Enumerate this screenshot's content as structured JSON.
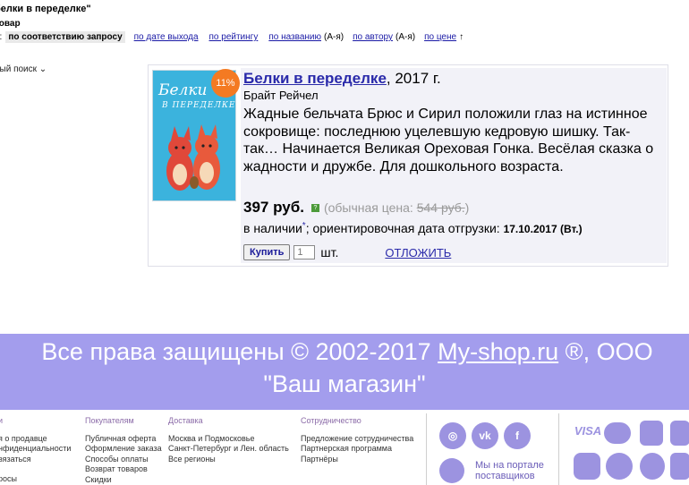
{
  "search": {
    "title": "белки в переделке\"",
    "found": "товар",
    "sort_prefix": "а:",
    "sort_active": "по соответствию запросу",
    "sort_by_date": "по дате выхода",
    "sort_by_rating": "по рейтингу",
    "sort_by_name": "по названию",
    "sort_by_name_note": "(А-я)",
    "sort_by_author": "по автору",
    "sort_by_author_note": "(А-я)",
    "sort_by_price": "по цене",
    "sort_arrow": "↑",
    "advanced": "ный поиск ⌄"
  },
  "product": {
    "discount": "11%",
    "cover_title": "Белки",
    "cover_subtitle": "В ПЕРЕДЕЛКЕ",
    "title": "Белки в переделке",
    "year": ", 2017 г.",
    "author": "Брайт Рейчел",
    "description": "Жадные бельчата Брюс и Сирил положили глаз на истинное сокровище: последнюю уцелевшую кедровую шишку. Так-так… Начинается Великая Ореховая Гонка. Весёлая сказка о жадности и дружбе. Для дошкольного возраста.",
    "price": "397 руб.",
    "info_icon": "?",
    "old_price_prefix": "(обычная цена: ",
    "old_price": "544 руб.",
    "old_price_suffix": ")",
    "stock": "в наличии",
    "stock_star": "*",
    "shipping_text": "; ориентировочная дата отгрузки: ",
    "shipping_date": "17.10.2017 (Вт.)",
    "buy_label": "Купить",
    "qty_value": "1",
    "qty_unit": "шт.",
    "postpone_label": "ОТЛОЖИТЬ"
  },
  "footer": {
    "copyright_prefix": "Все права защищены © 2002-2017 ",
    "site": "My-shop.ru",
    "copyright_suffix": " ®, ООО",
    "company": "\"Ваш магазин\"",
    "col1": {
      "head": "и",
      "items": [
        "я о продавце",
        "нфиденциальности",
        "вязаться",
        "",
        "росы"
      ]
    },
    "col2": {
      "head": "Покупателям",
      "items": [
        "Публичная оферта",
        "Оформление заказа",
        "Способы оплаты",
        "Возврат товаров",
        "Скидки"
      ]
    },
    "col3": {
      "head": "Доставка",
      "items": [
        "Москва и Подмосковье",
        "Санкт-Петербург и Лен. область",
        "Все регионы"
      ]
    },
    "col4": {
      "head": "Сотрудничество",
      "items": [
        "Предложение сотрудничества",
        "Партнерская программа",
        "Партнёры"
      ]
    },
    "portal_line1": "Мы на портале",
    "portal_line2": "поставщиков",
    "pay_visa": "VISA"
  },
  "colors": {
    "accent": "#a39ded",
    "link": "#2a2aaa",
    "discount": "#f47a22"
  }
}
